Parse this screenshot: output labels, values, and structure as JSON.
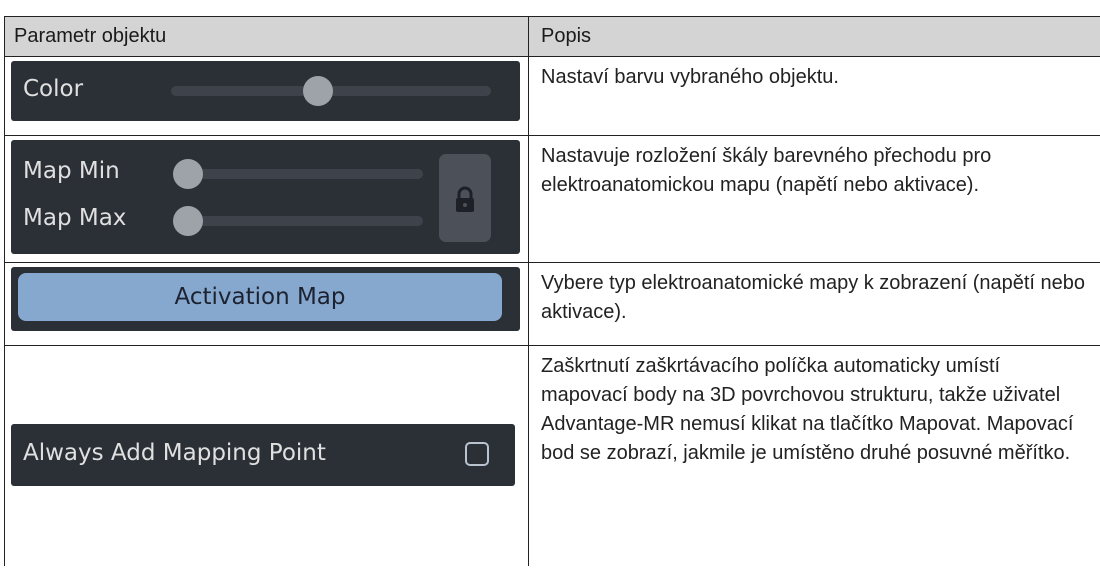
{
  "table": {
    "headers": {
      "param": "Parametr objektu",
      "desc": "Popis"
    },
    "rows": [
      {
        "widget": {
          "label": "Color"
        },
        "description": "Nastaví barvu vybraného objektu."
      },
      {
        "widget": {
          "min_label": "Map Min",
          "max_label": "Map Max",
          "lock_icon": "lock-icon"
        },
        "description": "Nastavuje rozložení škály barevného přechodu pro elektroanatomickou mapu (napětí nebo aktivace)."
      },
      {
        "widget": {
          "button_label": "Activation Map"
        },
        "description": "Vybere typ elektroanatomické mapy k zobrazení (napětí nebo aktivace)."
      },
      {
        "widget": {
          "label": "Always Add Mapping Point",
          "checked": false
        },
        "description": "Zaškrtnutí zaškrtávacího políčka automaticky umístí mapovací body na 3D povrchovou strukturu, takže uživatel Advantage-MR nemusí klikat na tlačítko Mapovat. Mapovací bod se zobrazí, jakmile je umístěno druhé posuvné měřítko."
      }
    ]
  },
  "colors": {
    "panel_bg": "#2b2f36",
    "button_blue": "#86a8cf",
    "header_bg": "#d4d4d4"
  }
}
